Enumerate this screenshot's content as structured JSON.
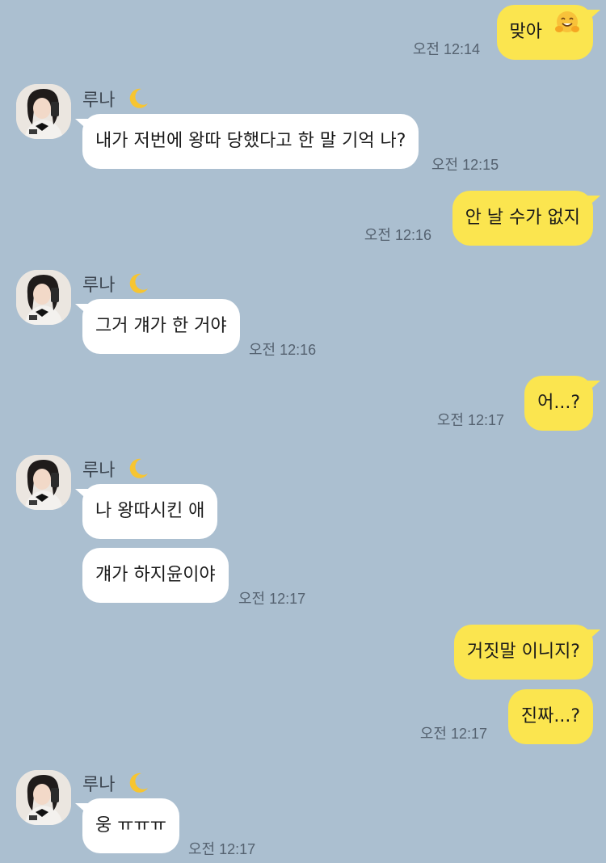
{
  "messages": {
    "m1": {
      "text": "맞아",
      "time": "오전 12:14",
      "emoji": "hugging-face"
    },
    "m2": {
      "sender": "루나",
      "text": "내가 저번에 왕따 당했다고 한 말 기억 나?",
      "time": "오전 12:15"
    },
    "m3": {
      "text": "안 날 수가 없지",
      "time": "오전 12:16"
    },
    "m4": {
      "sender": "루나",
      "text": "그거 걔가 한 거야",
      "time": "오전 12:16"
    },
    "m5": {
      "text": "어...?",
      "time": "오전 12:17"
    },
    "m6": {
      "sender": "루나",
      "text": "나 왕따시킨 애"
    },
    "m7": {
      "text": "걔가 하지윤이야",
      "time": "오전 12:17"
    },
    "m8": {
      "text": "거짓말 이니지?"
    },
    "m9": {
      "text": "진짜...?",
      "time": "오전 12:17"
    },
    "m10": {
      "sender": "루나",
      "text": "웅 ㅠㅠㅠ",
      "time": "오전 12:17"
    }
  },
  "colors": {
    "background": "#abbfd0",
    "mine_bubble": "#fbe54f",
    "their_bubble": "#ffffff"
  },
  "icons": {
    "sender_badge": "crescent-moon",
    "avatar": "profile-photo-girl-selfie"
  }
}
